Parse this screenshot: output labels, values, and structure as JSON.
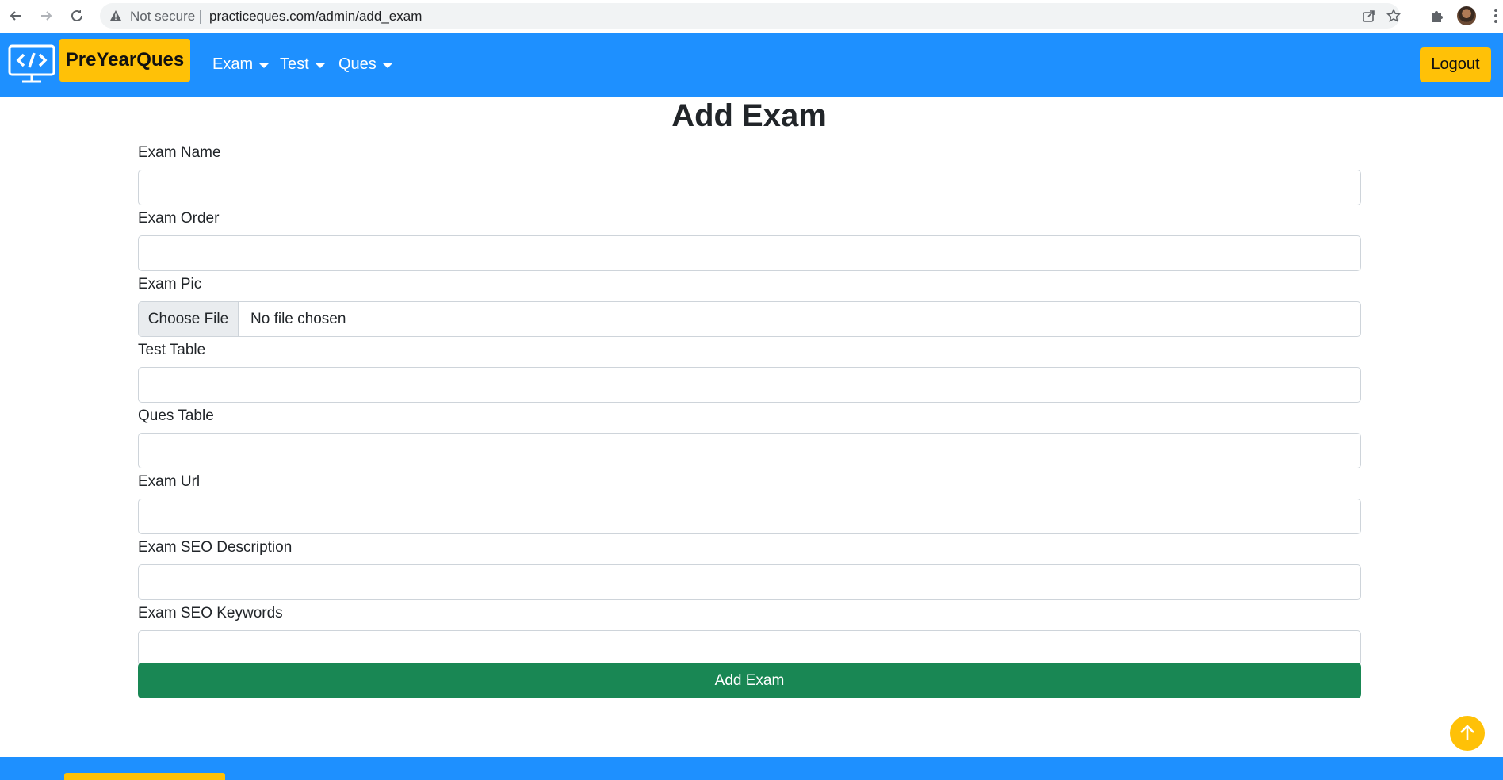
{
  "browser": {
    "security_label": "Not secure",
    "url": "practiceques.com/admin/add_exam"
  },
  "navbar": {
    "brand": "PreYearQues",
    "menus": [
      {
        "label": "Exam"
      },
      {
        "label": "Test"
      },
      {
        "label": "Ques"
      }
    ],
    "logout_label": "Logout",
    "colors": {
      "bar": "#1e90ff",
      "accent": "#ffc107"
    }
  },
  "form": {
    "title": "Add Exam",
    "fields": [
      {
        "label": "Exam Name",
        "value": ""
      },
      {
        "label": "Exam Order",
        "value": ""
      },
      {
        "label": "Exam Pic",
        "button": "Choose File",
        "status": "No file chosen"
      },
      {
        "label": "Test Table",
        "value": ""
      },
      {
        "label": "Ques Table",
        "value": ""
      },
      {
        "label": "Exam Url",
        "value": ""
      },
      {
        "label": "Exam SEO Description",
        "value": ""
      },
      {
        "label": "Exam SEO Keywords",
        "value": ""
      }
    ],
    "submit_label": "Add Exam",
    "submit_color": "#198754"
  },
  "icons": {
    "back": "arrow-left-icon",
    "forward": "arrow-right-icon",
    "reload": "reload-icon",
    "warning": "warning-icon",
    "share": "share-icon",
    "bookmark": "star-icon",
    "extensions": "puzzle-icon",
    "menu": "kebab-menu-icon",
    "logo": "monitor-code-icon",
    "scroll_top": "arrow-up-icon"
  }
}
